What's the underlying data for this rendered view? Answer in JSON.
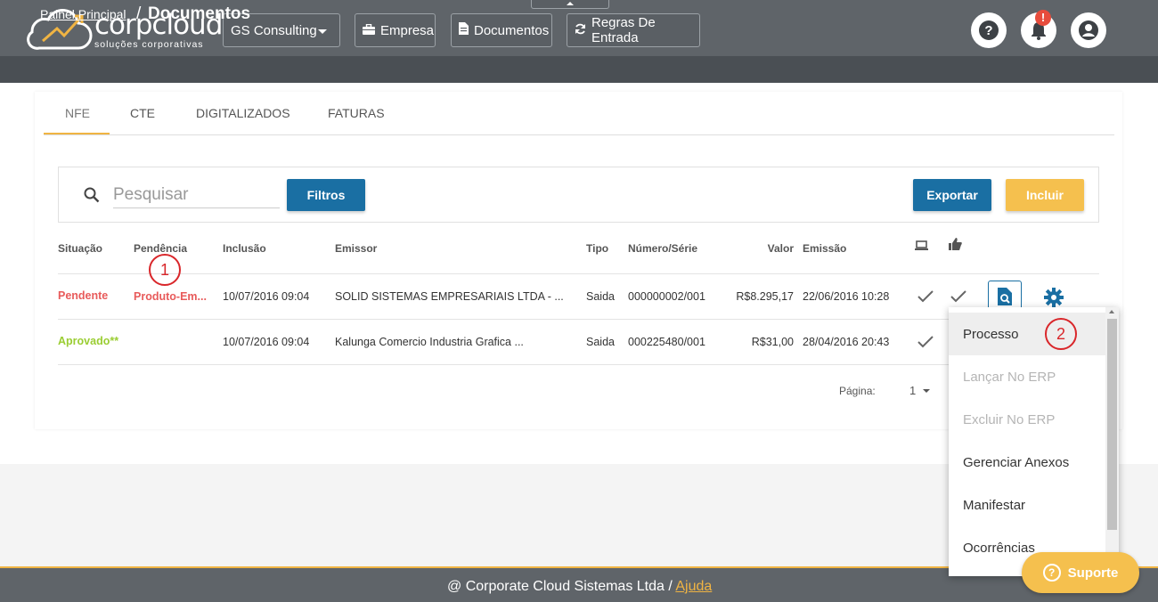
{
  "brand": {
    "name": "corpcloud",
    "tagline": "soluções corporativas"
  },
  "header": {
    "company": "GS Consulting",
    "nav": {
      "empresa": "Empresa",
      "documentos": "Documentos",
      "regras": "Regras De Entrada"
    },
    "notification_badge": "!"
  },
  "breadcrumb": {
    "home": "Painel Principal",
    "separator": "/",
    "current": "Documentos"
  },
  "tabs": [
    "NFE",
    "CTE",
    "DIGITALIZADOS",
    "FATURAS"
  ],
  "search": {
    "placeholder": "Pesquisar"
  },
  "buttons": {
    "filtros": "Filtros",
    "exportar": "Exportar",
    "incluir": "Incluir"
  },
  "table": {
    "columns": [
      "Situação",
      "Pendência",
      "Inclusão",
      "Emissor",
      "Tipo",
      "Número/Série",
      "Valor",
      "Emissão"
    ],
    "rows": [
      {
        "situacao": "Pendente",
        "pendencia": "Produto-Em...",
        "inclusao": "10/07/2016 09:04",
        "emissor": "SOLID SISTEMAS EMPRESARIAIS LTDA - ...",
        "tipo": "Saida",
        "numero": "000000002/001",
        "valor": "R$8.295,17",
        "emissao": "22/06/2016 10:28"
      },
      {
        "situacao": "Aprovado**",
        "pendencia": "",
        "inclusao": "10/07/2016 09:04",
        "emissor": "Kalunga Comercio Industria Grafica ...",
        "tipo": "Saida",
        "numero": "000225480/001",
        "valor": "R$31,00",
        "emissao": "28/04/2016 20:43"
      }
    ]
  },
  "pagination": {
    "label": "Página:",
    "value": "1"
  },
  "markers": {
    "one": "1",
    "two": "2"
  },
  "menu": {
    "items": [
      {
        "label": "Processo",
        "state": "hover"
      },
      {
        "label": "Lançar No ERP",
        "state": "disabled"
      },
      {
        "label": "Excluir No ERP",
        "state": "disabled"
      },
      {
        "label": "Gerenciar Anexos",
        "state": "normal"
      },
      {
        "label": "Manifestar",
        "state": "normal"
      },
      {
        "label": "Ocorrências",
        "state": "normal"
      }
    ]
  },
  "footer": {
    "text": "@ Corporate Cloud Sistemas Ltda /",
    "link": "Ajuda"
  },
  "support": {
    "label": "Suporte"
  },
  "colors": {
    "accent": "#f0b443",
    "primary": "#1a6fa3",
    "header": "#5f6469",
    "pending": "#e85b5b",
    "approved": "#9acd32",
    "marker": "#d9262a"
  },
  "icons": [
    "cloud-logo-icon",
    "briefcase-icon",
    "document-icon",
    "refresh-icon",
    "help-icon",
    "bell-icon",
    "user-icon",
    "search-icon",
    "monitor-icon",
    "thumbs-up-icon",
    "check-icon",
    "view-document-icon",
    "gear-icon",
    "question-icon"
  ]
}
